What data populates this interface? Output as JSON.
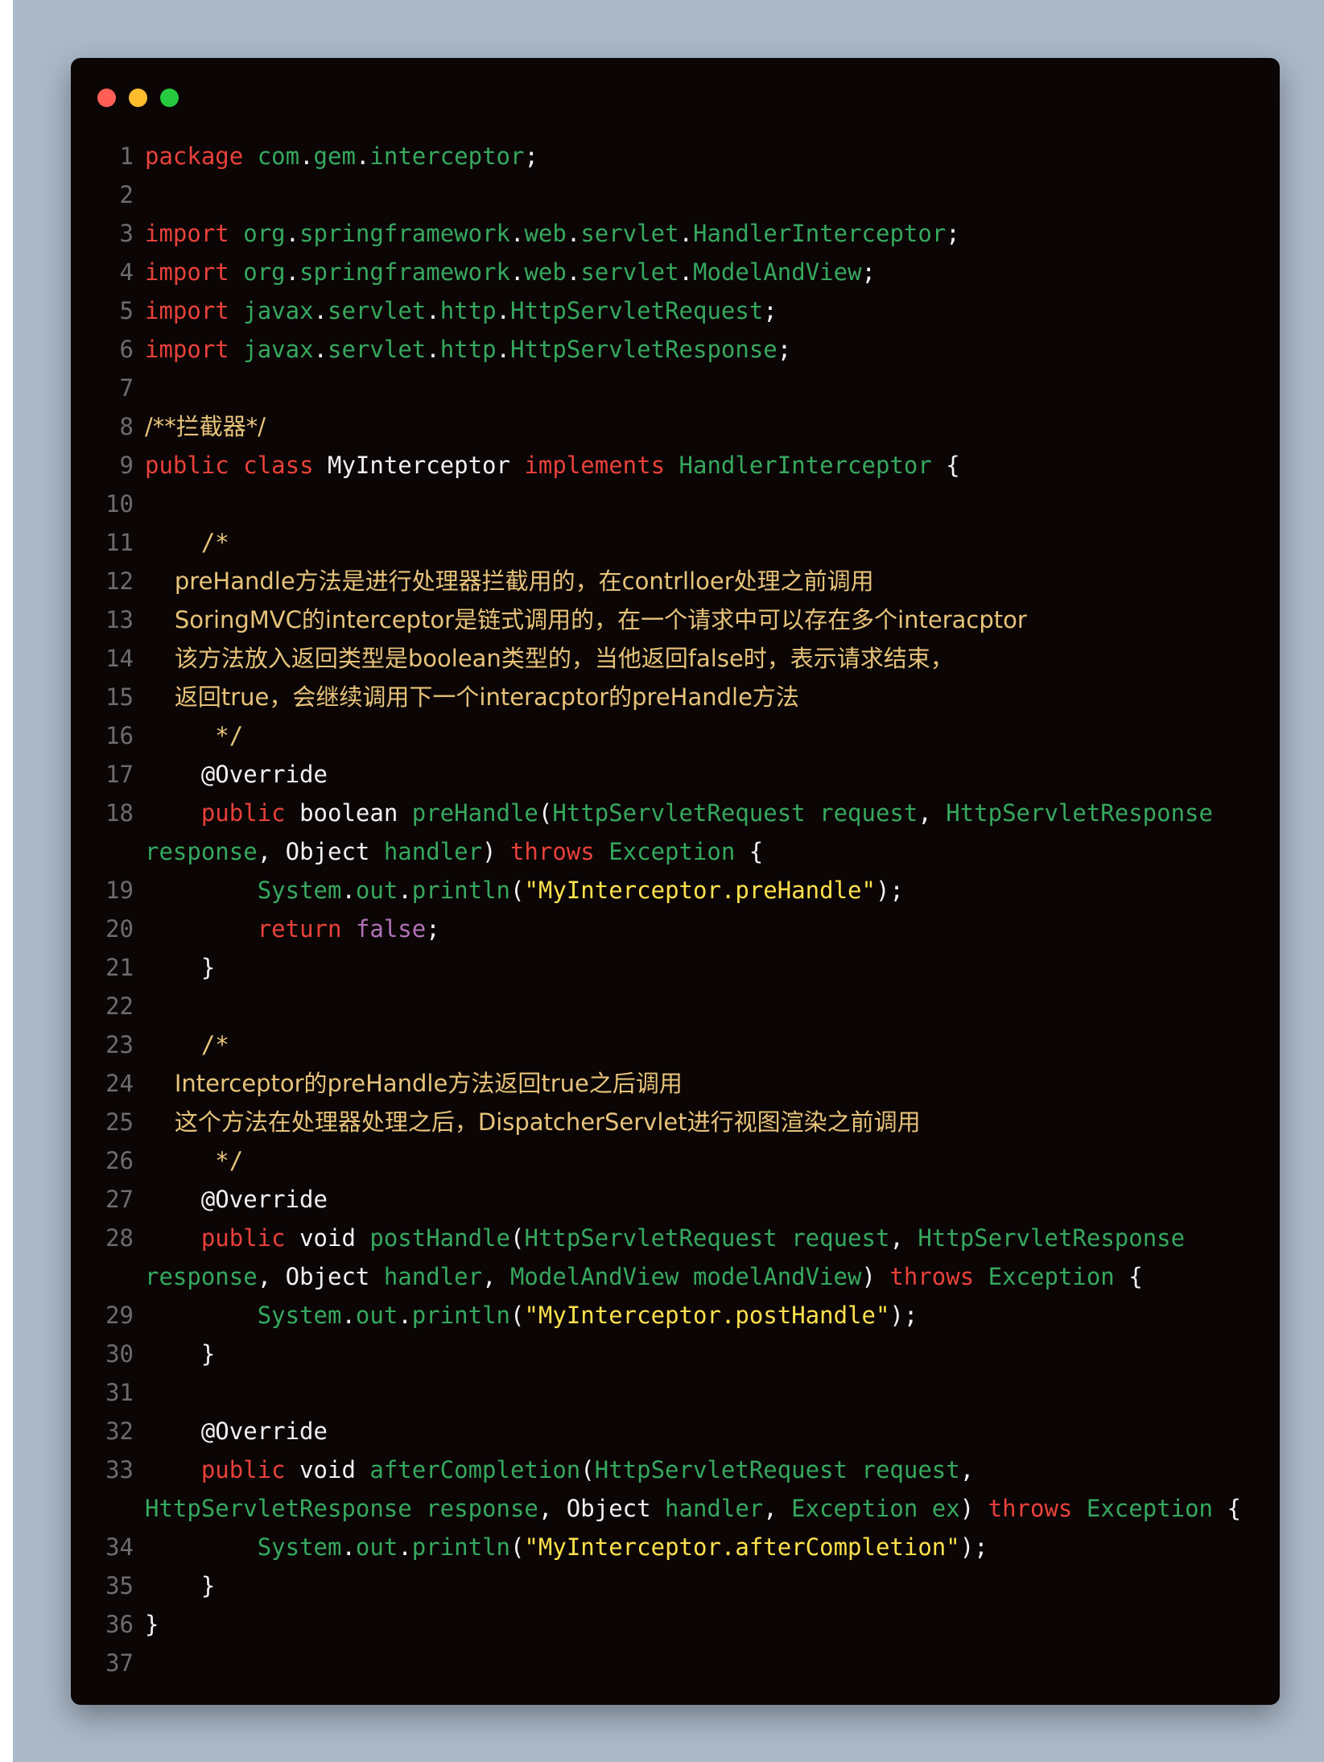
{
  "colors": {
    "background": "#abb8c8",
    "window": "#0b0505",
    "line_number": "#6c6c6c",
    "keyword": "#e8413a",
    "identifier": "#36a85f",
    "comment": "#e7c37a",
    "string": "#ffe14d",
    "plain": "#f1f1f1",
    "false_literal": "#b072b8"
  },
  "window_controls": [
    {
      "name": "close-dot",
      "color": "#ff5f56"
    },
    {
      "name": "minimize-dot",
      "color": "#ffbd2e"
    },
    {
      "name": "maximize-dot",
      "color": "#27c93f"
    }
  ],
  "lines": [
    {
      "n": "1",
      "t": [
        [
          "k",
          "package"
        ],
        [
          "p",
          " "
        ],
        [
          "i",
          "com"
        ],
        [
          "p",
          "."
        ],
        [
          "i",
          "gem"
        ],
        [
          "p",
          "."
        ],
        [
          "i",
          "interceptor"
        ],
        [
          "p",
          ";"
        ]
      ]
    },
    {
      "n": "2",
      "t": []
    },
    {
      "n": "3",
      "t": [
        [
          "k",
          "import"
        ],
        [
          "p",
          " "
        ],
        [
          "i",
          "org"
        ],
        [
          "p",
          "."
        ],
        [
          "i",
          "springframework"
        ],
        [
          "p",
          "."
        ],
        [
          "i",
          "web"
        ],
        [
          "p",
          "."
        ],
        [
          "i",
          "servlet"
        ],
        [
          "p",
          "."
        ],
        [
          "i",
          "HandlerInterceptor"
        ],
        [
          "p",
          ";"
        ]
      ]
    },
    {
      "n": "4",
      "t": [
        [
          "k",
          "import"
        ],
        [
          "p",
          " "
        ],
        [
          "i",
          "org"
        ],
        [
          "p",
          "."
        ],
        [
          "i",
          "springframework"
        ],
        [
          "p",
          "."
        ],
        [
          "i",
          "web"
        ],
        [
          "p",
          "."
        ],
        [
          "i",
          "servlet"
        ],
        [
          "p",
          "."
        ],
        [
          "i",
          "ModelAndView"
        ],
        [
          "p",
          ";"
        ]
      ]
    },
    {
      "n": "5",
      "t": [
        [
          "k",
          "import"
        ],
        [
          "p",
          " "
        ],
        [
          "i",
          "javax"
        ],
        [
          "p",
          "."
        ],
        [
          "i",
          "servlet"
        ],
        [
          "p",
          "."
        ],
        [
          "i",
          "http"
        ],
        [
          "p",
          "."
        ],
        [
          "i",
          "HttpServletRequest"
        ],
        [
          "p",
          ";"
        ]
      ]
    },
    {
      "n": "6",
      "t": [
        [
          "k",
          "import"
        ],
        [
          "p",
          " "
        ],
        [
          "i",
          "javax"
        ],
        [
          "p",
          "."
        ],
        [
          "i",
          "servlet"
        ],
        [
          "p",
          "."
        ],
        [
          "i",
          "http"
        ],
        [
          "p",
          "."
        ],
        [
          "i",
          "HttpServletResponse"
        ],
        [
          "p",
          ";"
        ]
      ]
    },
    {
      "n": "7",
      "t": []
    },
    {
      "n": "8",
      "t": [
        [
          "c",
          "/**拦截器*/"
        ]
      ]
    },
    {
      "n": "9",
      "t": [
        [
          "k",
          "public"
        ],
        [
          "p",
          " "
        ],
        [
          "k",
          "class"
        ],
        [
          "p",
          " MyInterceptor "
        ],
        [
          "k",
          "implements"
        ],
        [
          "p",
          " "
        ],
        [
          "i",
          "HandlerInterceptor"
        ],
        [
          "p",
          " {"
        ]
      ]
    },
    {
      "n": "10",
      "t": []
    },
    {
      "n": "11",
      "t": [
        [
          "c",
          "    /*"
        ]
      ]
    },
    {
      "n": "12",
      "t": [
        [
          "c",
          "    preHandle方法是进行处理器拦截用的，在contrlloer处理之前调用"
        ]
      ]
    },
    {
      "n": "13",
      "t": [
        [
          "c",
          "    SoringMVC的interceptor是链式调用的，在一个请求中可以存在多个interacptor"
        ]
      ]
    },
    {
      "n": "14",
      "t": [
        [
          "c",
          "    该方法放入返回类型是boolean类型的，当他返回false时，表示请求结束，"
        ]
      ]
    },
    {
      "n": "15",
      "t": [
        [
          "c",
          "    返回true，会继续调用下一个interacptor的preHandle方法"
        ]
      ]
    },
    {
      "n": "16",
      "t": [
        [
          "c",
          "     */"
        ]
      ]
    },
    {
      "n": "17",
      "t": [
        [
          "p",
          "    @Override"
        ]
      ]
    },
    {
      "n": "18",
      "t": [
        [
          "p",
          "    "
        ],
        [
          "k",
          "public"
        ],
        [
          "p",
          " boolean "
        ],
        [
          "i",
          "preHandle"
        ],
        [
          "p",
          "("
        ],
        [
          "i",
          "HttpServletRequest"
        ],
        [
          "p",
          " "
        ],
        [
          "i",
          "request"
        ],
        [
          "p",
          ", "
        ],
        [
          "i",
          "HttpServletResponse"
        ]
      ],
      "t2": [
        [
          "i",
          "response"
        ],
        [
          "p",
          ", Object "
        ],
        [
          "i",
          "handler"
        ],
        [
          "p",
          ") "
        ],
        [
          "k",
          "throws"
        ],
        [
          "p",
          " "
        ],
        [
          "i",
          "Exception"
        ],
        [
          "p",
          " {"
        ]
      ]
    },
    {
      "n": "19",
      "t": [
        [
          "p",
          "        "
        ],
        [
          "i",
          "System"
        ],
        [
          "p",
          "."
        ],
        [
          "i",
          "out"
        ],
        [
          "p",
          "."
        ],
        [
          "i",
          "println"
        ],
        [
          "p",
          "("
        ],
        [
          "s",
          "\"MyInterceptor.preHandle\""
        ],
        [
          "p",
          ");"
        ]
      ]
    },
    {
      "n": "20",
      "t": [
        [
          "p",
          "        "
        ],
        [
          "k",
          "return"
        ],
        [
          "p",
          " "
        ],
        [
          "f",
          "false"
        ],
        [
          "p",
          ";"
        ]
      ]
    },
    {
      "n": "21",
      "t": [
        [
          "p",
          "    }"
        ]
      ]
    },
    {
      "n": "22",
      "t": []
    },
    {
      "n": "23",
      "t": [
        [
          "c",
          "    /*"
        ]
      ]
    },
    {
      "n": "24",
      "t": [
        [
          "c",
          "    Interceptor的preHandle方法返回true之后调用"
        ]
      ]
    },
    {
      "n": "25",
      "t": [
        [
          "c",
          "    这个方法在处理器处理之后，DispatcherServlet进行视图渲染之前调用"
        ]
      ]
    },
    {
      "n": "26",
      "t": [
        [
          "c",
          "     */"
        ]
      ]
    },
    {
      "n": "27",
      "t": [
        [
          "p",
          "    @Override"
        ]
      ]
    },
    {
      "n": "28",
      "t": [
        [
          "p",
          "    "
        ],
        [
          "k",
          "public"
        ],
        [
          "p",
          " void "
        ],
        [
          "i",
          "postHandle"
        ],
        [
          "p",
          "("
        ],
        [
          "i",
          "HttpServletRequest"
        ],
        [
          "p",
          " "
        ],
        [
          "i",
          "request"
        ],
        [
          "p",
          ", "
        ],
        [
          "i",
          "HttpServletResponse"
        ]
      ],
      "t2": [
        [
          "i",
          "response"
        ],
        [
          "p",
          ", Object "
        ],
        [
          "i",
          "handler"
        ],
        [
          "p",
          ", "
        ],
        [
          "i",
          "ModelAndView"
        ],
        [
          "p",
          " "
        ],
        [
          "i",
          "modelAndView"
        ],
        [
          "p",
          ") "
        ],
        [
          "k",
          "throws"
        ],
        [
          "p",
          " "
        ],
        [
          "i",
          "Exception"
        ],
        [
          "p",
          " {"
        ]
      ]
    },
    {
      "n": "29",
      "t": [
        [
          "p",
          "        "
        ],
        [
          "i",
          "System"
        ],
        [
          "p",
          "."
        ],
        [
          "i",
          "out"
        ],
        [
          "p",
          "."
        ],
        [
          "i",
          "println"
        ],
        [
          "p",
          "("
        ],
        [
          "s",
          "\"MyInterceptor.postHandle\""
        ],
        [
          "p",
          ");"
        ]
      ]
    },
    {
      "n": "30",
      "t": [
        [
          "p",
          "    }"
        ]
      ]
    },
    {
      "n": "31",
      "t": []
    },
    {
      "n": "32",
      "t": [
        [
          "p",
          "    @Override"
        ]
      ]
    },
    {
      "n": "33",
      "t": [
        [
          "p",
          "    "
        ],
        [
          "k",
          "public"
        ],
        [
          "p",
          " void "
        ],
        [
          "i",
          "afterCompletion"
        ],
        [
          "p",
          "("
        ],
        [
          "i",
          "HttpServletRequest"
        ],
        [
          "p",
          " "
        ],
        [
          "i",
          "request"
        ],
        [
          "p",
          ","
        ]
      ],
      "t2": [
        [
          "i",
          "HttpServletResponse"
        ],
        [
          "p",
          " "
        ],
        [
          "i",
          "response"
        ],
        [
          "p",
          ", Object "
        ],
        [
          "i",
          "handler"
        ],
        [
          "p",
          ", "
        ],
        [
          "i",
          "Exception"
        ],
        [
          "p",
          " "
        ],
        [
          "i",
          "ex"
        ],
        [
          "p",
          ") "
        ],
        [
          "k",
          "throws"
        ],
        [
          "p",
          " "
        ],
        [
          "i",
          "Exception"
        ],
        [
          "p",
          " {"
        ]
      ]
    },
    {
      "n": "34",
      "t": [
        [
          "p",
          "        "
        ],
        [
          "i",
          "System"
        ],
        [
          "p",
          "."
        ],
        [
          "i",
          "out"
        ],
        [
          "p",
          "."
        ],
        [
          "i",
          "println"
        ],
        [
          "p",
          "("
        ],
        [
          "s",
          "\"MyInterceptor.afterCompletion\""
        ],
        [
          "p",
          ");"
        ]
      ]
    },
    {
      "n": "35",
      "t": [
        [
          "p",
          "    }"
        ]
      ]
    },
    {
      "n": "36",
      "t": [
        [
          "p",
          "}"
        ]
      ]
    },
    {
      "n": "37",
      "t": []
    }
  ]
}
